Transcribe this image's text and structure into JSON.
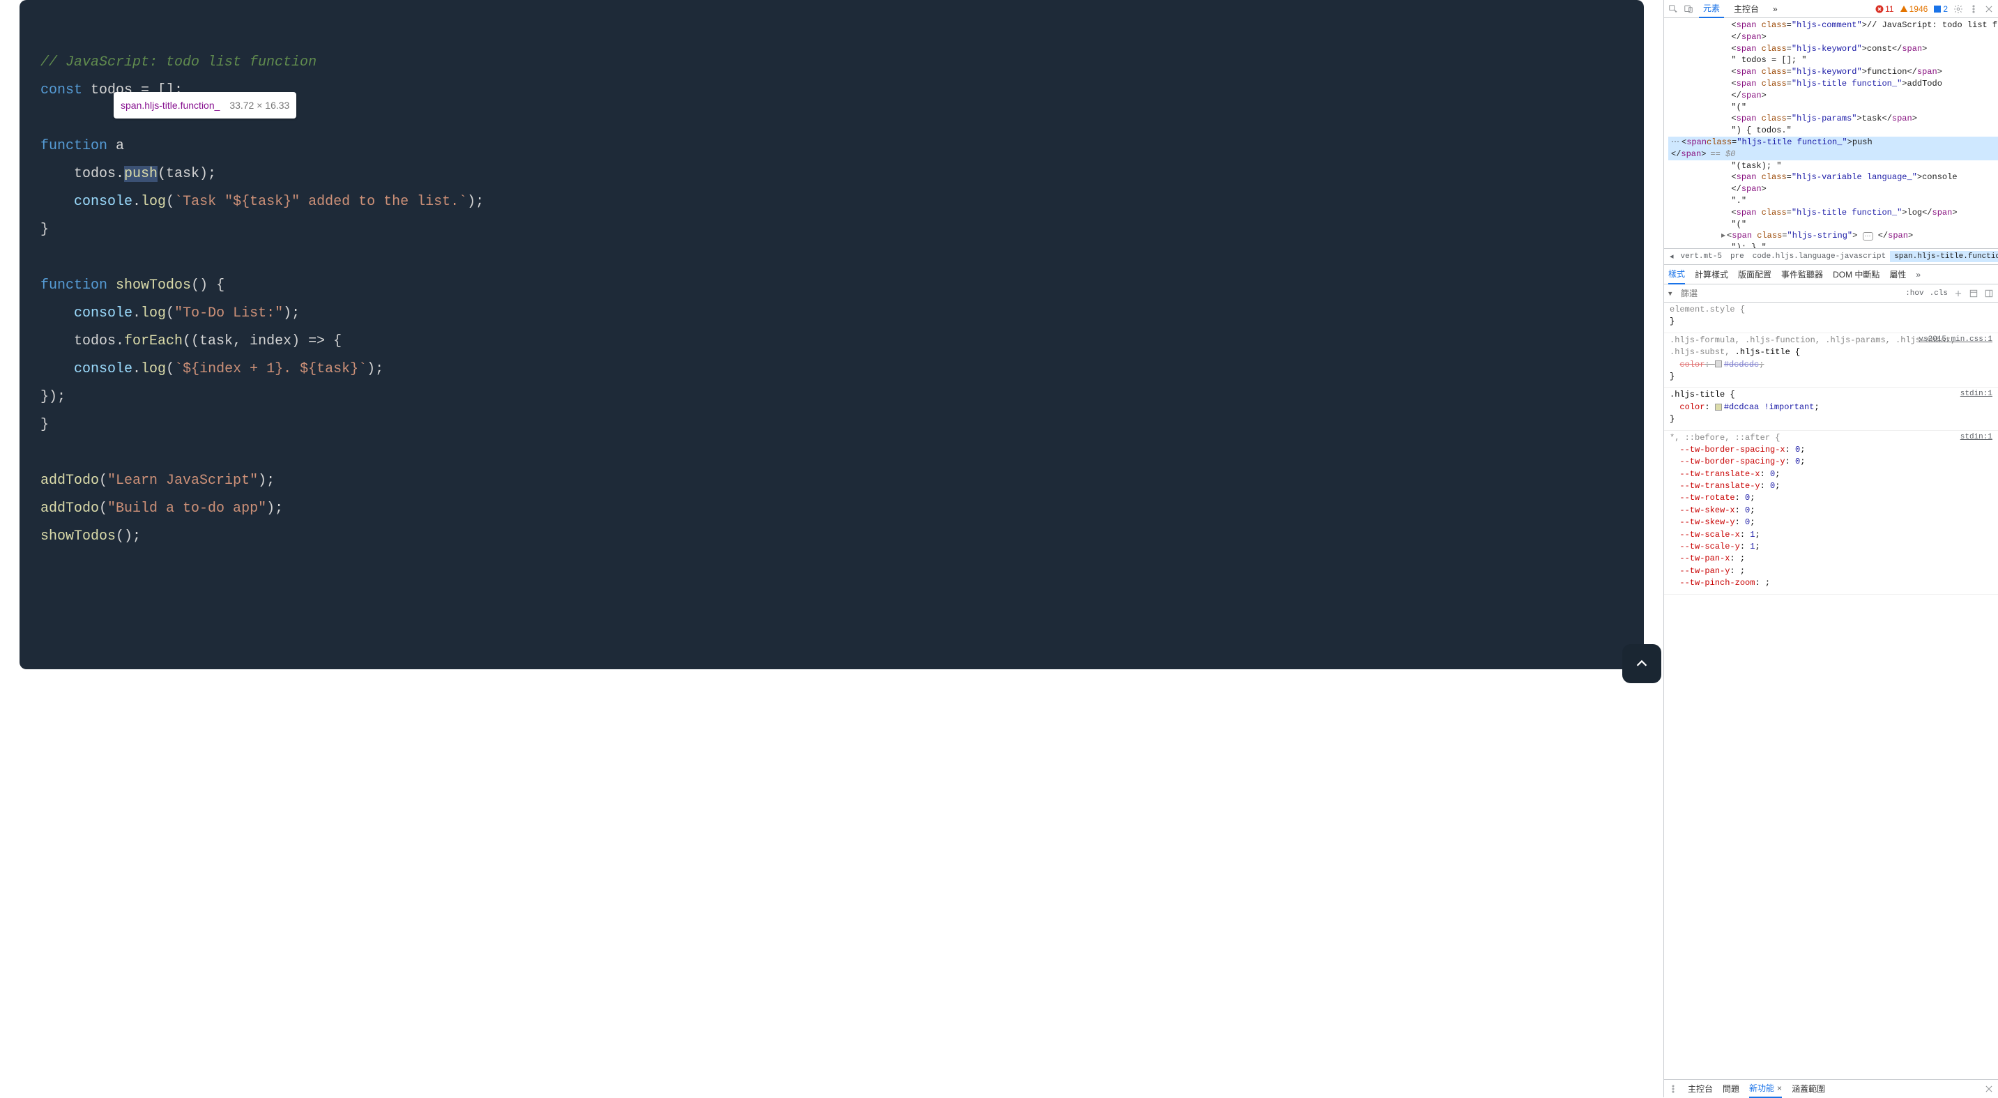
{
  "code": {
    "comment": "// JavaScript: todo list function",
    "l2_const": "const",
    "l2_rest": " todos = [];",
    "l4_fn": "function",
    "l4_a": " a",
    "l5_pre": "    todos.",
    "l5_push": "push",
    "l5_post": "(task);",
    "l6_pre": "    ",
    "l6_console": "console",
    "l6_dot": ".",
    "l6_log": "log",
    "l6_open": "(",
    "l6_str": "`Task \"${task}\" added to the list.`",
    "l6_close": ");",
    "l7_brace": "}",
    "l9_fn": "function",
    "l9_sp": " ",
    "l9_show": "showTodos",
    "l9_rest": "() {",
    "l10_pre": "    ",
    "l10_console": "console",
    "l10_dot": ".",
    "l10_log": "log",
    "l10_open": "(",
    "l10_str": "\"To-Do List:\"",
    "l10_close": ");",
    "l11_pre": "    todos.",
    "l11_foreach": "forEach",
    "l11_rest": "((task, index) => {",
    "l12_pre": "    ",
    "l12_console": "console",
    "l12_dot": ".",
    "l12_log": "log",
    "l12_open": "(",
    "l12_str": "`${index + 1}. ${task}`",
    "l12_close": ");",
    "l13": "});",
    "l14": "}",
    "l16_addtodo": "addTodo",
    "l16_open": "(",
    "l16_str": "\"Learn JavaScript\"",
    "l16_close": ");",
    "l17_addtodo": "addTodo",
    "l17_open": "(",
    "l17_str": "\"Build a to-do app\"",
    "l17_close": ");",
    "l18_show": "showTodos",
    "l18_rest": "();"
  },
  "tooltip": {
    "selector": "span.hljs-title.function_",
    "dims": "33.72 × 16.33"
  },
  "devtools": {
    "tabs": {
      "elements": "元素",
      "console": "主控台",
      "more": "»"
    },
    "counts": {
      "errors": "11",
      "warnings": "1946",
      "info": "2"
    },
    "tree": {
      "l1": "// JavaScript: todo list function",
      "l2": "const",
      "l3": "\" todos = []; \"",
      "l4": "function",
      "l5": "addTodo",
      "l6": "\"(\"",
      "l7": "task",
      "l8": "\") { todos.\"",
      "l9": "push",
      "l9eq": "== $0",
      "l10": "\"(task); \"",
      "l11": "console",
      "l12": "\".\"",
      "l13": "log",
      "l14": "\"(\"",
      "l16": "\"); } \"",
      "cls_comment": "hljs-comment",
      "cls_keyword": "hljs-keyword",
      "cls_titlefn": "hljs-title function_",
      "cls_params": "hljs-params",
      "cls_varlang": "hljs-variable language_",
      "cls_string": "hljs-string"
    },
    "crumbs": {
      "c1": "vert.mt-5",
      "c2": "pre",
      "c3": "code.hljs.language-javascript",
      "c4": "span.hljs-title.function_"
    },
    "styletabs": {
      "styles": "樣式",
      "computed": "計算樣式",
      "layout": "版面配置",
      "listeners": "事件監聽器",
      "dom": "DOM 中斷點",
      "props": "屬性",
      "more": "»"
    },
    "filter": {
      "placeholder": "篩選",
      "hov": ":hov",
      "cls": ".cls"
    },
    "rules": {
      "r0_sel": "element.style {",
      "r0_close": "}",
      "r1_sel": ".hljs-formula, .hljs-function, .hljs-params, .hljs-subst, ",
      "r1_sel_bold": ".hljs-title",
      "r1_open": " {",
      "r1_src": "vs2015.min.css:1",
      "r1_prop": "color",
      "r1_val": "#dcdcdc",
      "r1_close": "}",
      "r2_sel": ".hljs-title {",
      "r2_src": "stdin:1",
      "r2_prop": "color",
      "r2_val": "#dcdcaa !important",
      "r2_close": "}",
      "r3_sel": "*, ::before, ::after {",
      "r3_src": "stdin:1",
      "p1n": "--tw-border-spacing-x",
      "p1v": "0",
      "p2n": "--tw-border-spacing-y",
      "p2v": "0",
      "p3n": "--tw-translate-x",
      "p3v": "0",
      "p4n": "--tw-translate-y",
      "p4v": "0",
      "p5n": "--tw-rotate",
      "p5v": "0",
      "p6n": "--tw-skew-x",
      "p6v": "0",
      "p7n": "--tw-skew-y",
      "p7v": "0",
      "p8n": "--tw-scale-x",
      "p8v": "1",
      "p9n": "--tw-scale-y",
      "p9v": "1",
      "p10n": "--tw-pan-x",
      "p10v": "",
      "p11n": "--tw-pan-y",
      "p11v": "",
      "p12n": "--tw-pinch-zoom",
      "p12v": ""
    },
    "drawer": {
      "console": "主控台",
      "issues": "問題",
      "whatsnew": "新功能",
      "coverage": "涵蓋範圍"
    }
  }
}
